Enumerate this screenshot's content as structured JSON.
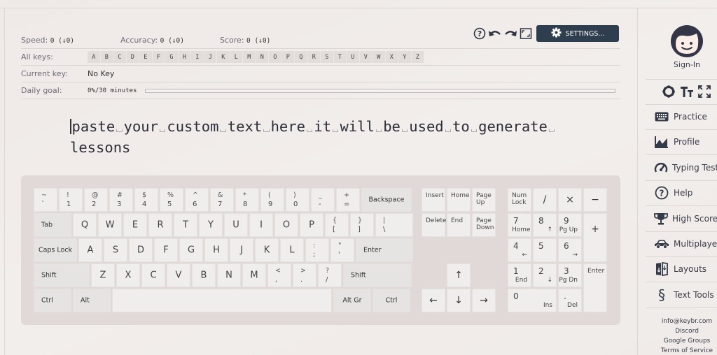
{
  "stats": {
    "speed_label": "Speed:",
    "speed_value": "0 (↓0)",
    "accuracy_label": "Accuracy:",
    "accuracy_value": "0 (↓0)",
    "score_label": "Score:",
    "score_value": "0 (↓0)",
    "all_keys_label": "All keys:",
    "all_keys": [
      "A",
      "B",
      "C",
      "D",
      "E",
      "F",
      "G",
      "H",
      "I",
      "J",
      "K",
      "L",
      "M",
      "N",
      "O",
      "P",
      "Q",
      "R",
      "S",
      "T",
      "U",
      "V",
      "W",
      "X",
      "Y",
      "Z"
    ],
    "current_key_label": "Current key:",
    "current_key_value": "No Key",
    "daily_goal_label": "Daily goal:",
    "daily_goal_value": "0%/30 minutes",
    "daily_goal_progress_percent": 0
  },
  "toolbar": {
    "help_icon": "help-circle",
    "undo_icon": "undo",
    "redo_icon": "redo",
    "fullscreen_icon": "fullscreen",
    "settings_label": "SETTINGS..."
  },
  "practice_text": {
    "words_line1": [
      "paste",
      "your",
      "custom",
      "text",
      "here",
      "it",
      "will",
      "be",
      "used",
      "to",
      "generate"
    ],
    "words_line2": [
      "lessons"
    ]
  },
  "keyboard": {
    "row1": [
      {
        "top": "~",
        "bottom": "`"
      },
      {
        "top": "!",
        "bottom": "1"
      },
      {
        "top": "@",
        "bottom": "2"
      },
      {
        "top": "#",
        "bottom": "3"
      },
      {
        "top": "$",
        "bottom": "4"
      },
      {
        "top": "%",
        "bottom": "5"
      },
      {
        "top": "^",
        "bottom": "6"
      },
      {
        "top": "&",
        "bottom": "7"
      },
      {
        "top": "*",
        "bottom": "8"
      },
      {
        "top": "(",
        "bottom": "9"
      },
      {
        "top": ")",
        "bottom": "0"
      },
      {
        "top": "_",
        "bottom": "-"
      },
      {
        "top": "+",
        "bottom": "="
      }
    ],
    "backspace": "Backspace",
    "tab": "Tab",
    "row2": [
      "Q",
      "W",
      "E",
      "R",
      "T",
      "Y",
      "U",
      "I",
      "O",
      "P"
    ],
    "row2_sym": [
      {
        "top": "{",
        "bottom": "["
      },
      {
        "top": "}",
        "bottom": "]"
      },
      {
        "top": "|",
        "bottom": "\\"
      }
    ],
    "caps": "Caps Lock",
    "row3": [
      "A",
      "S",
      "D",
      "F",
      "G",
      "H",
      "J",
      "K",
      "L"
    ],
    "row3_sym": [
      {
        "top": ":",
        "bottom": ";"
      },
      {
        "top": "\"",
        "bottom": "'"
      }
    ],
    "enter": "Enter",
    "shift_left": "Shift",
    "row4": [
      "Z",
      "X",
      "C",
      "V",
      "B",
      "N",
      "M"
    ],
    "row4_sym": [
      {
        "top": "<",
        "bottom": ","
      },
      {
        "top": ">",
        "bottom": "."
      },
      {
        "top": "?",
        "bottom": "/"
      }
    ],
    "shift_right": "Shift",
    "ctrl_left": "Ctrl",
    "alt": "Alt",
    "altgr": "Alt Gr",
    "ctrl_right": "Ctrl",
    "nav": {
      "insert": "Insert",
      "home": "Home",
      "page_up": "Page Up",
      "delete": "Delete",
      "end": "End",
      "page_down": "Page Down",
      "up": "↑",
      "left": "←",
      "down": "↓",
      "right": "→"
    },
    "numpad": {
      "numlock": "Num Lock",
      "divide": "/",
      "multiply": "×",
      "minus": "−",
      "n7": "7",
      "n7b": "Home",
      "n8": "8",
      "n8b": "↑",
      "n9": "9",
      "n9b": "Pg Up",
      "plus": "+",
      "n4": "4",
      "n4b": "←",
      "n5": "5",
      "n6": "6",
      "n6b": "→",
      "n1": "1",
      "n1b": "End",
      "n2": "2",
      "n2b": "↓",
      "n3": "3",
      "n3b": "Pg Dn",
      "enter": "Enter",
      "n0": "0",
      "n0b": "Ins",
      "dot": ".",
      "dotb": "Del"
    }
  },
  "sidebar": {
    "sign_in": "Sign-In",
    "tools": [
      "theme-icon",
      "font-size-icon",
      "fullscreen-icon"
    ],
    "items": [
      {
        "label": "Practice",
        "icon": "keyboard"
      },
      {
        "label": "Profile",
        "icon": "chart"
      },
      {
        "label": "Typing Test",
        "icon": "gauge"
      },
      {
        "label": "Help",
        "icon": "help"
      },
      {
        "label": "High Scores",
        "icon": "trophy"
      },
      {
        "label": "Multiplayer",
        "icon": "car"
      },
      {
        "label": "Layouts",
        "icon": "layouts"
      },
      {
        "label": "Text Tools",
        "icon": "section"
      }
    ],
    "footer": [
      "info@keybr.com",
      "Discord",
      "Google Groups",
      "Terms of Service"
    ]
  }
}
